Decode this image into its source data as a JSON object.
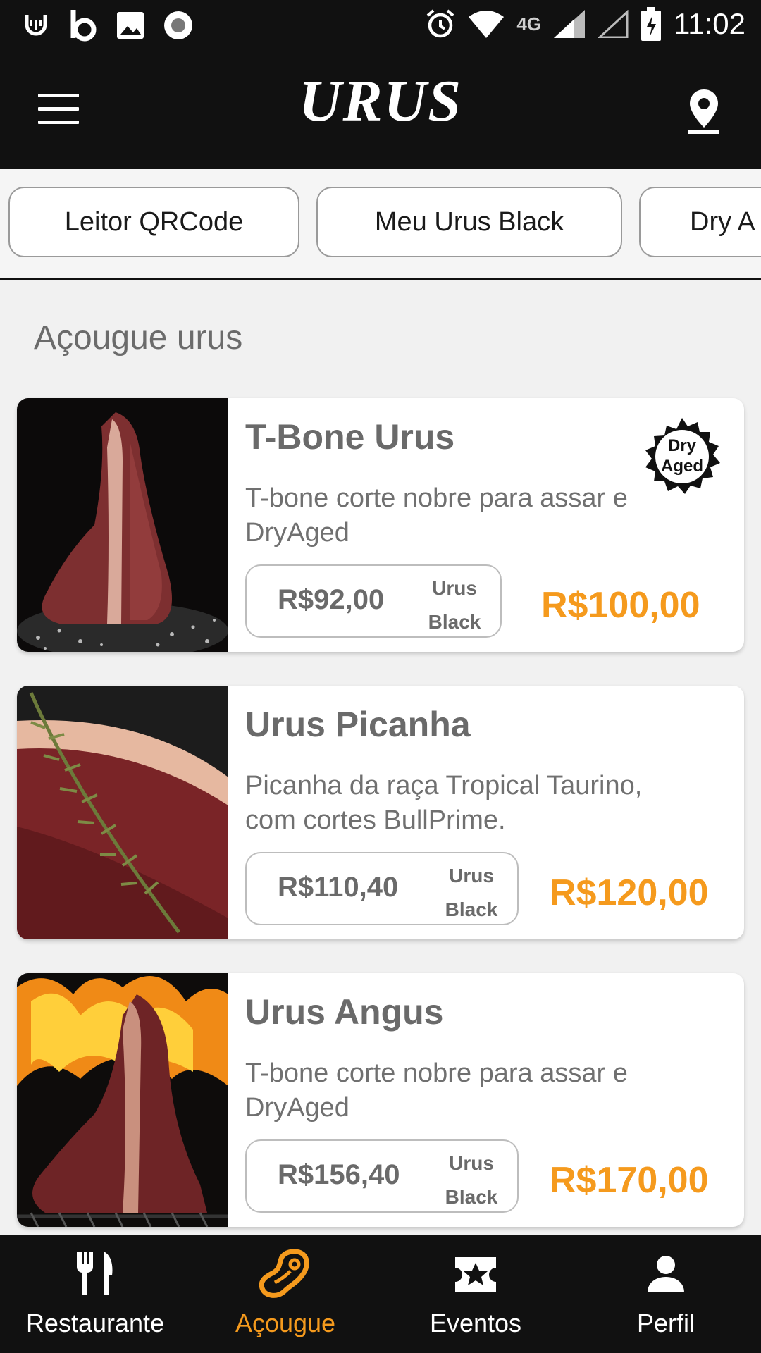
{
  "status_bar": {
    "time": "11:02",
    "network": "4G"
  },
  "header": {
    "logo": "URUS"
  },
  "chips": [
    "Leitor QRCode",
    "Meu Urus Black",
    "Dry A"
  ],
  "section_title": "Açougue urus",
  "products": [
    {
      "name": "T-Bone Urus",
      "description": "T-bone corte nobre para assar e DryAged",
      "member_price": "R$92,00",
      "member_tag_line1": "Urus",
      "member_tag_line2": "Black",
      "price": "R$100,00",
      "badge": {
        "line1": "Dry",
        "line2": "Aged"
      }
    },
    {
      "name": "Urus Picanha",
      "description": "Picanha da raça Tropical Taurino, com cortes BullPrime.",
      "member_price": "R$110,40",
      "member_tag_line1": "Urus",
      "member_tag_line2": "Black",
      "price": "R$120,00"
    },
    {
      "name": "Urus Angus",
      "description": "T-bone corte nobre para assar e DryAged",
      "member_price": "R$156,40",
      "member_tag_line1": "Urus",
      "member_tag_line2": "Black",
      "price": "R$170,00"
    }
  ],
  "bottom_nav": [
    {
      "label": "Restaurante",
      "icon": "fork-knife-icon"
    },
    {
      "label": "Açougue",
      "icon": "steak-icon",
      "active": true
    },
    {
      "label": "Eventos",
      "icon": "ticket-star-icon"
    },
    {
      "label": "Perfil",
      "icon": "person-icon"
    }
  ],
  "colors": {
    "accent": "#f59a1d",
    "bar": "#111111",
    "background": "#f1f1f1"
  }
}
